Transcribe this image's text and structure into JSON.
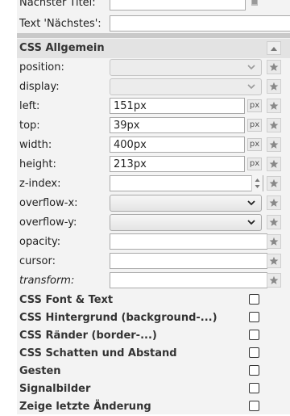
{
  "top_fields": {
    "next_title_label": "Nächster Titel:",
    "next_text_label": "Text 'Nächstes':"
  },
  "css_general": {
    "title": "CSS Allgemein",
    "rows": {
      "position": {
        "label": "position:"
      },
      "display": {
        "label": "display:"
      },
      "left": {
        "label": "left:",
        "value": "151px",
        "unit": "px"
      },
      "top": {
        "label": "top:",
        "value": "39px",
        "unit": "px"
      },
      "width": {
        "label": "width:",
        "value": "400px",
        "unit": "px"
      },
      "height": {
        "label": "height:",
        "value": "213px",
        "unit": "px"
      },
      "zindex": {
        "label": "z-index:",
        "value": ""
      },
      "overflow_x": {
        "label": "overflow-x:"
      },
      "overflow_y": {
        "label": "overflow-y:"
      },
      "opacity": {
        "label": "opacity:",
        "value": ""
      },
      "cursor": {
        "label": "cursor:",
        "value": ""
      },
      "transform": {
        "label": "transform:",
        "value": ""
      }
    }
  },
  "collapsed_sections": [
    {
      "title": "CSS Font & Text"
    },
    {
      "title": "CSS Hintergrund (background-...)"
    },
    {
      "title": "CSS Ränder (border-...)"
    },
    {
      "title": "CSS Schatten und Abstand"
    },
    {
      "title": "Gesten"
    },
    {
      "title": "Signalbilder"
    },
    {
      "title": "Zeige letzte Änderung"
    }
  ],
  "icons": {
    "star": "star-icon",
    "chevron": "chevron-down-icon",
    "collapse": "triangle-up-icon",
    "list": "list-icon"
  },
  "colors": {
    "panel_bg": "#f3f3f3",
    "section_header_bg": "#e3e3e3",
    "separator": "#c9c9c9"
  }
}
